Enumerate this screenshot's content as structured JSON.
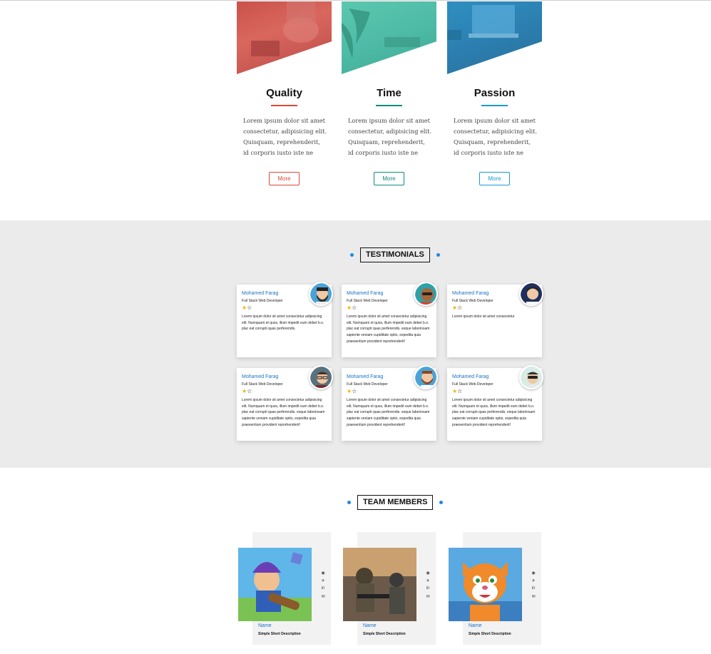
{
  "features": [
    {
      "title": "Quality",
      "text": "Lorem ipsum dolor sit amet consectetur, adipisicing elit. Quisquam, reprehenderit, id corporis iusto iste ne",
      "more": "More",
      "color": "#e0453a",
      "image_color": "#cc5a52"
    },
    {
      "title": "Time",
      "text": "Lorem ipsum dolor sit amet consectetur, adipisicing elit. Quisquam, reprehenderit, id corporis iusto iste ne",
      "more": "More",
      "color": "#0f8a7e",
      "image_color": "#4fbea8"
    },
    {
      "title": "Passion",
      "text": "Lorem ipsum dolor sit amet consectetur, adipisicing elit. Quisquam, reprehenderit, id corporis iusto iste ne",
      "more": "More",
      "color": "#1a9ad6",
      "image_color": "#2c8fbd"
    }
  ],
  "testimonials": {
    "title": "TESTIMONIALS",
    "items": [
      {
        "name": "Mohamed Farag",
        "role": "Full Stack Web Developer",
        "stars": "★☆",
        "text": "Lorem ipsum dolor sit amet consectetur adipisicing elit. Numquam et quos, illum impedit eum debet b.o. plac eat corrupti quas perferendis.",
        "avatar_icon": "bearded-man-avatar-icon"
      },
      {
        "name": "Mohamed Farag",
        "role": "Full Stack Web Developer",
        "stars": "★☆",
        "text": "Lorem ipsum dolor sit amet consectetur adipisicing elit. Numquam et quos, illum impedit eum debet b.o. plac eat corrupti quas perferendis. esque laboriosam sapiente veniam cupiditate optio, expedita quia praesentium provident reprehenderit!",
        "avatar_icon": "man-sunglasses-avatar-icon"
      },
      {
        "name": "Mohamed Farag",
        "role": "Full Stack Web Developer",
        "stars": "★☆",
        "text": "Lorem ipsum dolor sit amet consectetur",
        "avatar_icon": "man-suit-avatar-icon"
      },
      {
        "name": "Mohamed Farag",
        "role": "Full Stack Web Developer",
        "stars": "★☆",
        "text": "Lorem ipsum dolor sit amet consectetur adipisicing elit. Numquam et quos, illum impedit eum debet b.o. plac eat corrupti quas perferendis. esque laboriosam sapiente veniam cupiditate optio, expedita quia praesentium provident reprehenderit!",
        "avatar_icon": "man-glasses-avatar-icon"
      },
      {
        "name": "Mohamed Farag",
        "role": "Full Stack Web Developer",
        "stars": "★☆",
        "text": "Lorem ipsum dolor sit amet consectetur adipisicing elit. Numquam et quos, illum impedit eum debet b.o. plac eat corrupti quas perferendis. esque laboriosam sapiente veniam cupiditate optio, expedita quia praesentium provident reprehenderit!",
        "avatar_icon": "bearded-man-blue-avatar-icon"
      },
      {
        "name": "Mohamed Farag",
        "role": "Full Stack Web Developer",
        "stars": "★☆",
        "text": "Lorem ipsum dolor sit amet consectetur adipisicing elit. Numquam et quos, illum impedit eum debet b.o. plac eat corrupti quas perferendis. esque laboriosam sapiente veniam cupiditate optio, expedita quia praesentium provident reprehenderit!",
        "avatar_icon": "man-shades-avatar-icon"
      }
    ]
  },
  "team": {
    "title": "TEAM MEMBERS",
    "members": [
      {
        "name": "Name",
        "desc": "Simple Short Description",
        "photo_icon": "cartoon-soldier-icon"
      },
      {
        "name": "Name",
        "desc": "Simple Short Description",
        "photo_icon": "game-soldier-icon"
      },
      {
        "name": "Name",
        "desc": "Simple Short Description",
        "photo_icon": "cartoon-tiger-icon"
      }
    ],
    "social_icons": [
      "globe-icon",
      "twitter-icon",
      "linkedin-icon",
      "mail-icon"
    ]
  }
}
